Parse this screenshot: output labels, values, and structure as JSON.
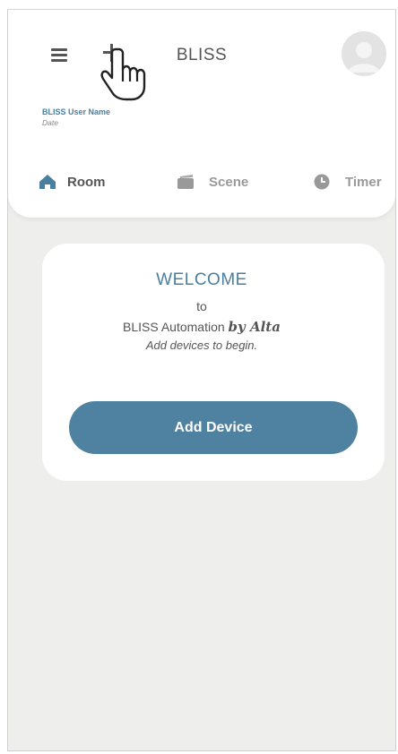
{
  "header": {
    "title": "BLISS",
    "user_name": "BLISS User Name",
    "date": "Date",
    "icons": {
      "menu": "hamburger-menu-icon",
      "add": "plus-icon",
      "avatar": "user-avatar-icon",
      "cursor": "pointing-hand-cursor-icon"
    }
  },
  "tabs": [
    {
      "label": "Room",
      "icon": "home-icon",
      "active": true
    },
    {
      "label": "Scene",
      "icon": "scene-icon",
      "active": false
    },
    {
      "label": "Timer",
      "icon": "clock-icon",
      "active": false
    }
  ],
  "welcome_card": {
    "heading": "WELCOME",
    "to": "to",
    "product": "BLISS Automation",
    "brand": "by Alta",
    "hint": "Add devices to begin.",
    "button_label": "Add Device"
  },
  "colors": {
    "accent": "#4f82a0",
    "accent_text": "#4a7f9f",
    "background": "#eeeeec",
    "active_tab_icon": "#4a7f9f",
    "inactive_tab": "#999999"
  }
}
